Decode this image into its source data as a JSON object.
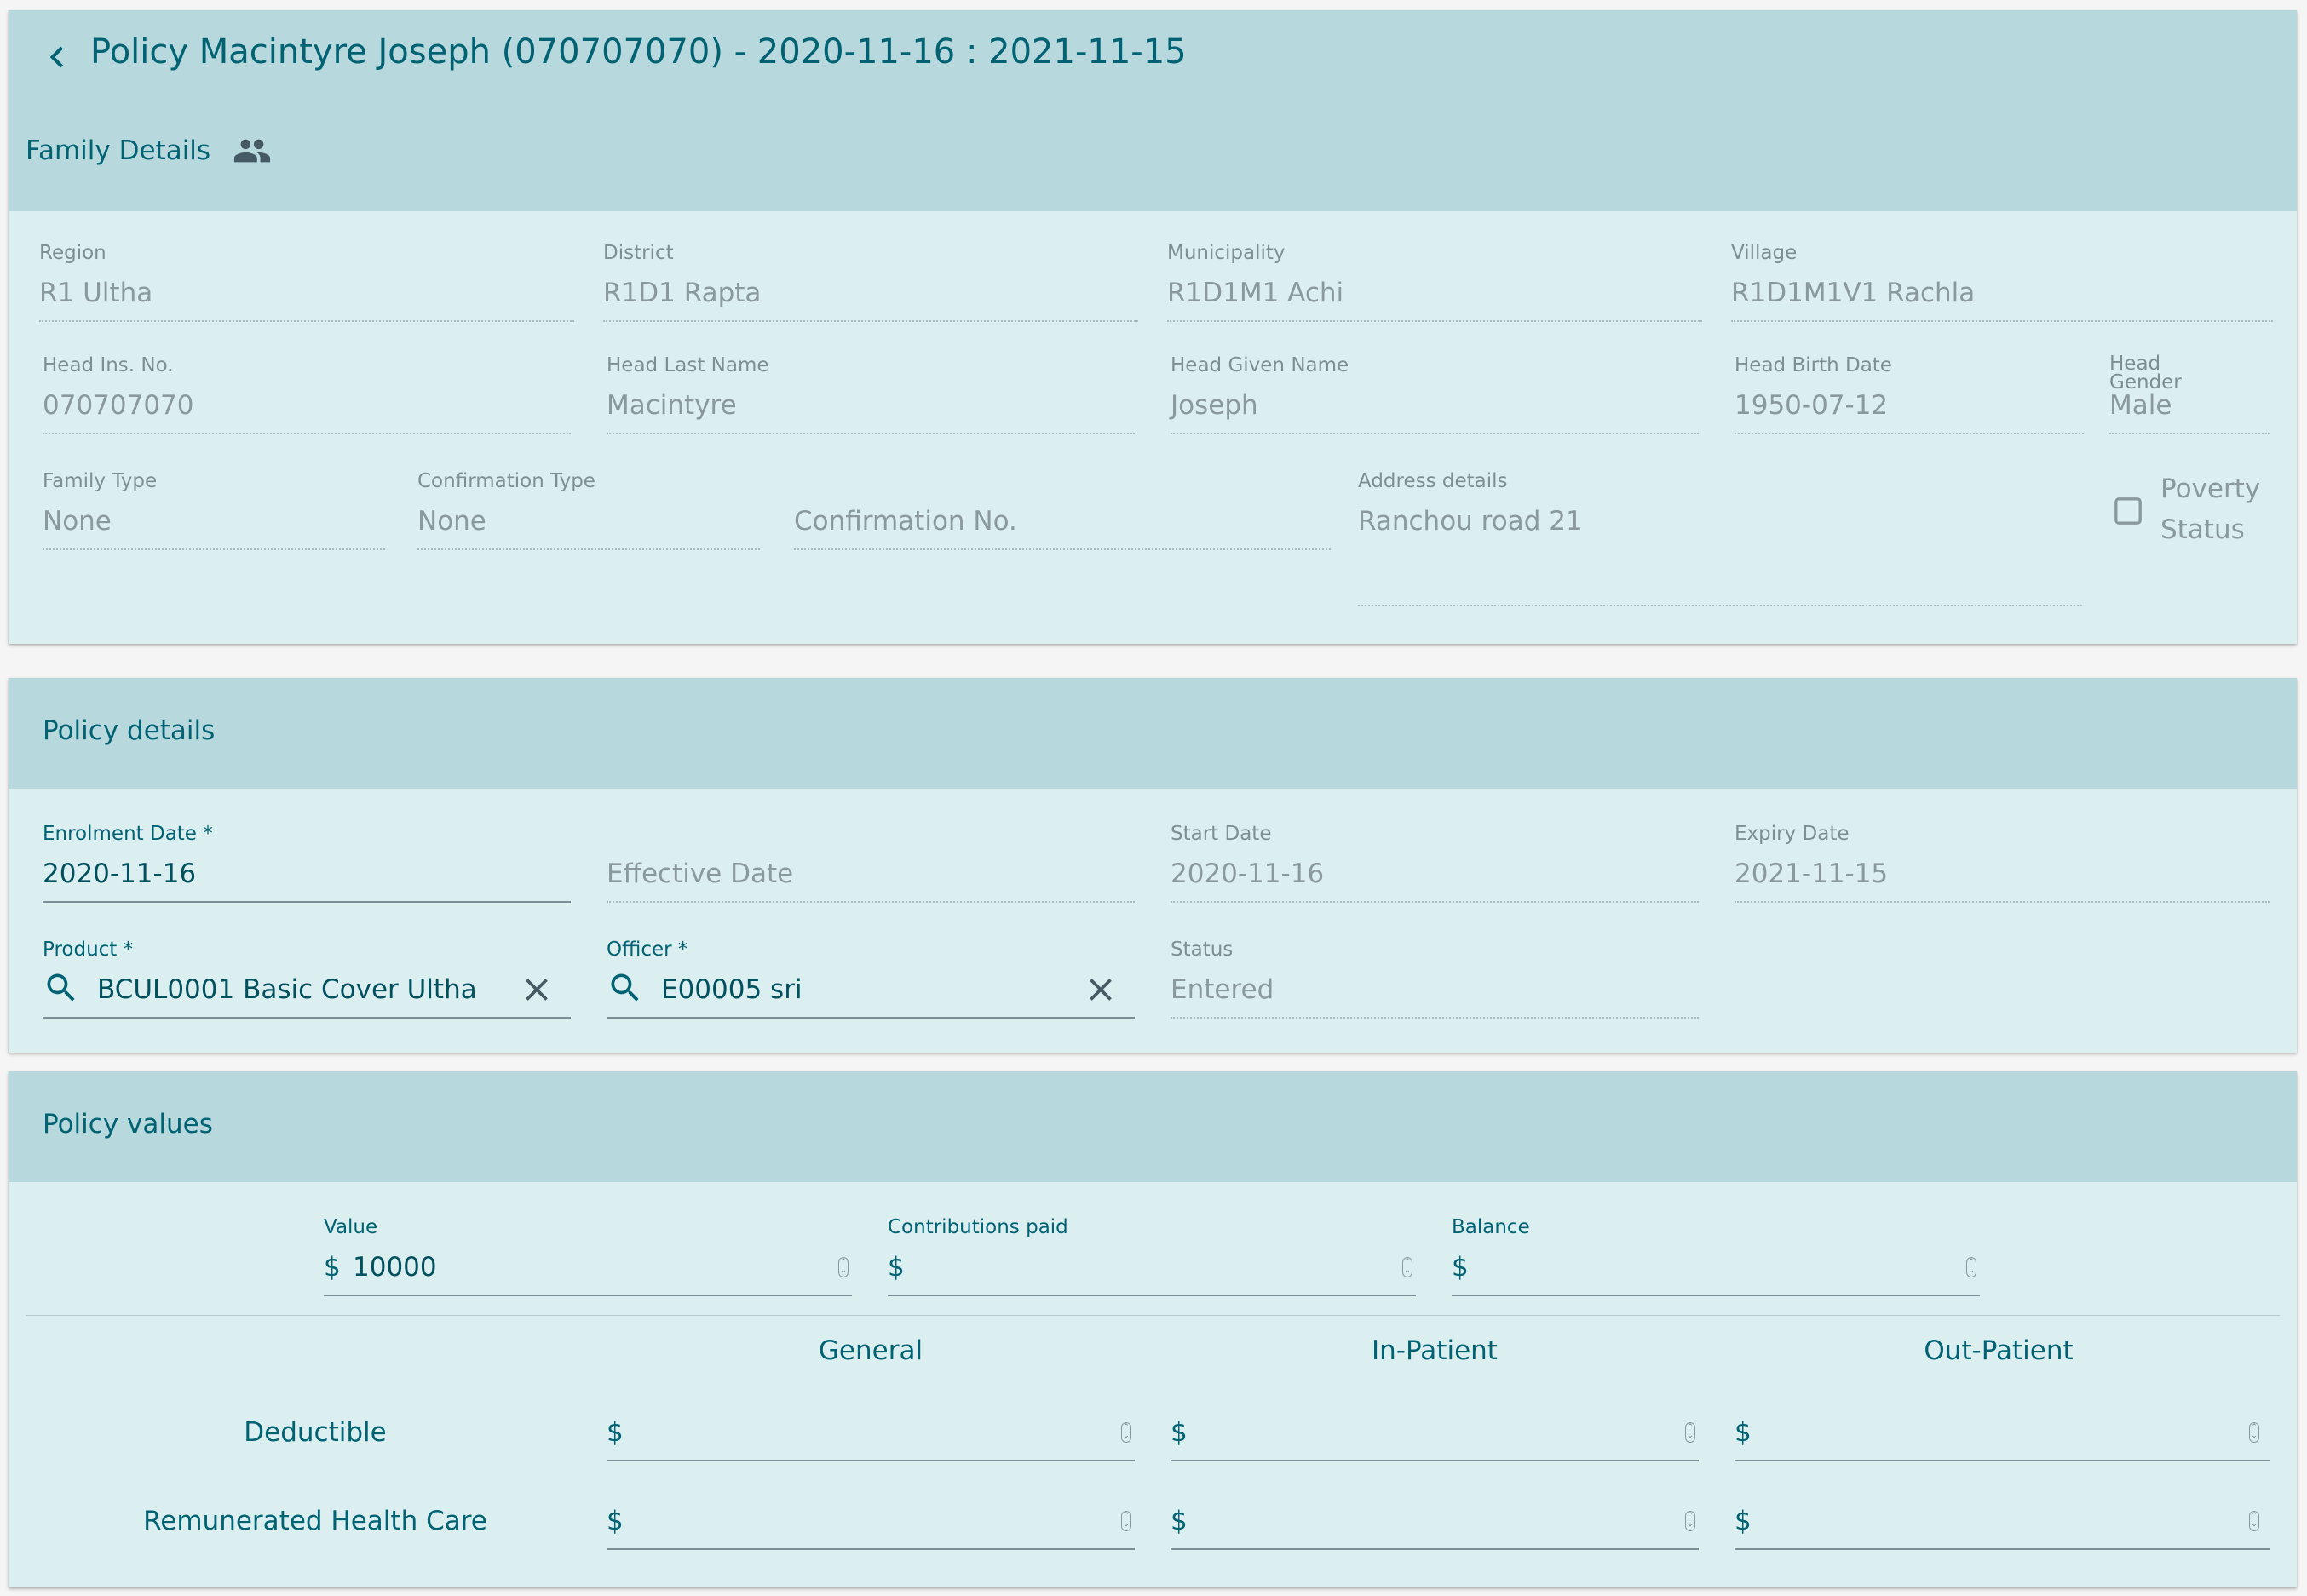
{
  "header": {
    "title": "Policy Macintyre Joseph (070707070) - 2020-11-16 : 2021-11-15",
    "family_section_label": "Family Details"
  },
  "family": {
    "region": {
      "label": "Region",
      "value": "R1 Ultha"
    },
    "district": {
      "label": "District",
      "value": "R1D1 Rapta"
    },
    "municipality": {
      "label": "Municipality",
      "value": "R1D1M1 Achi"
    },
    "village": {
      "label": "Village",
      "value": "R1D1M1V1 Rachla"
    },
    "head_ins_no": {
      "label": "Head Ins. No.",
      "value": "070707070"
    },
    "head_last_name": {
      "label": "Head Last Name",
      "value": "Macintyre"
    },
    "head_given_name": {
      "label": "Head Given Name",
      "value": "Joseph"
    },
    "head_birth_date": {
      "label": "Head Birth Date",
      "value": "1950-07-12"
    },
    "head_gender": {
      "label_line1": "Head",
      "label_line2": "Gender",
      "value": "Male"
    },
    "family_type": {
      "label": "Family Type",
      "value": "None"
    },
    "confirmation_type": {
      "label": "Confirmation Type",
      "value": "None"
    },
    "confirmation_no": {
      "placeholder": "Confirmation No."
    },
    "address_details": {
      "label": "Address details",
      "value": "Ranchou road 21"
    },
    "poverty_status": {
      "label_line1": "Poverty",
      "label_line2": "Status",
      "checked": false
    }
  },
  "policy_details": {
    "title": "Policy details",
    "enrolment_date": {
      "label": "Enrolment Date *",
      "value": "2020-11-16"
    },
    "effective_date": {
      "placeholder": "Effective Date"
    },
    "start_date": {
      "label": "Start Date",
      "value": "2020-11-16"
    },
    "expiry_date": {
      "label": "Expiry Date",
      "value": "2021-11-15"
    },
    "product": {
      "label": "Product *",
      "value": "BCUL0001 Basic Cover Ultha"
    },
    "officer": {
      "label": "Officer *",
      "value": "E00005 sri"
    },
    "status": {
      "label": "Status",
      "value": "Entered"
    }
  },
  "policy_values": {
    "title": "Policy values",
    "currency": "$",
    "value": {
      "label": "Value",
      "value": "10000"
    },
    "contributions_paid": {
      "label": "Contributions paid",
      "value": ""
    },
    "balance": {
      "label": "Balance",
      "value": ""
    },
    "columns": [
      "General",
      "In-Patient",
      "Out-Patient"
    ],
    "rows": [
      {
        "label": "Deductible",
        "values": [
          "",
          "",
          ""
        ]
      },
      {
        "label": "Remunerated Health Care",
        "values": [
          "",
          "",
          ""
        ]
      }
    ]
  },
  "colors": {
    "primary": "#006273",
    "header_bg": "#b7d8dc",
    "card_bg": "#dceff0"
  },
  "icons": {
    "back": "chevron-left-icon",
    "family": "people-icon",
    "search": "search-icon",
    "clear": "close-icon",
    "checkbox": "checkbox-icon",
    "spinner": "spinner-icon"
  }
}
